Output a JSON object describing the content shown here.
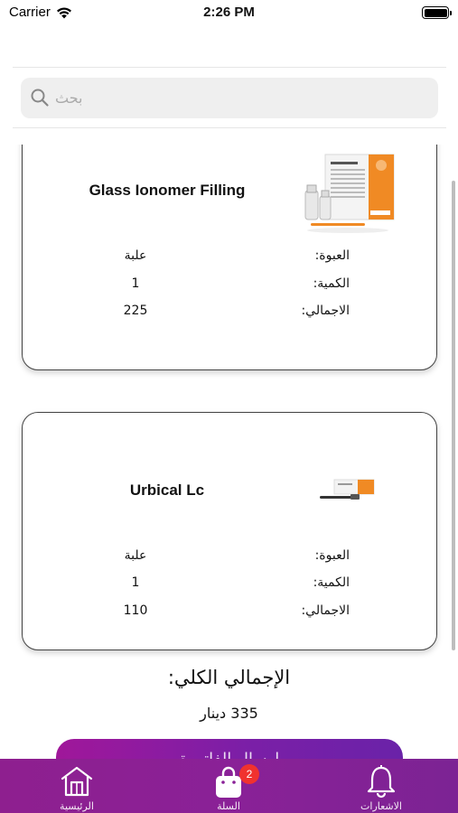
{
  "status_bar": {
    "carrier": "Carrier",
    "time": "2:26 PM"
  },
  "search": {
    "placeholder": "بحث"
  },
  "cart_items": [
    {
      "name": "Glass Ionomer Filling",
      "image": "medifil-product-box",
      "package_label": "العبوة:",
      "package_value": "علبة",
      "quantity_label": "الكمية:",
      "quantity_value": "1",
      "total_label": "الاجمالي:",
      "total_value": "225"
    },
    {
      "name": "Urbical Lc",
      "image": "urbical-syringe-product",
      "package_label": "العبوة:",
      "package_value": "علبة",
      "quantity_label": "الكمية:",
      "quantity_value": "1",
      "total_label": "الاجمالي:",
      "total_value": "110"
    }
  ],
  "summary": {
    "grand_total_label": "الإجمالي الكلي:",
    "grand_total_amount": "335 دينار"
  },
  "checkout": {
    "label": "ارسال الفاتورة"
  },
  "tab_bar": {
    "home_label": "الرئيسية",
    "home_icon": "home-icon",
    "cart_label": "السلة",
    "cart_icon": "shopping-bag-icon",
    "cart_badge": "2",
    "notifications_label": "الاشعارات",
    "notifications_icon": "bell-icon"
  },
  "colors": {
    "tab_bar": "#8a2197",
    "badge": "#f0322f",
    "checkout_gradient_start": "#a0179a",
    "checkout_gradient_end": "#6a22a8"
  }
}
